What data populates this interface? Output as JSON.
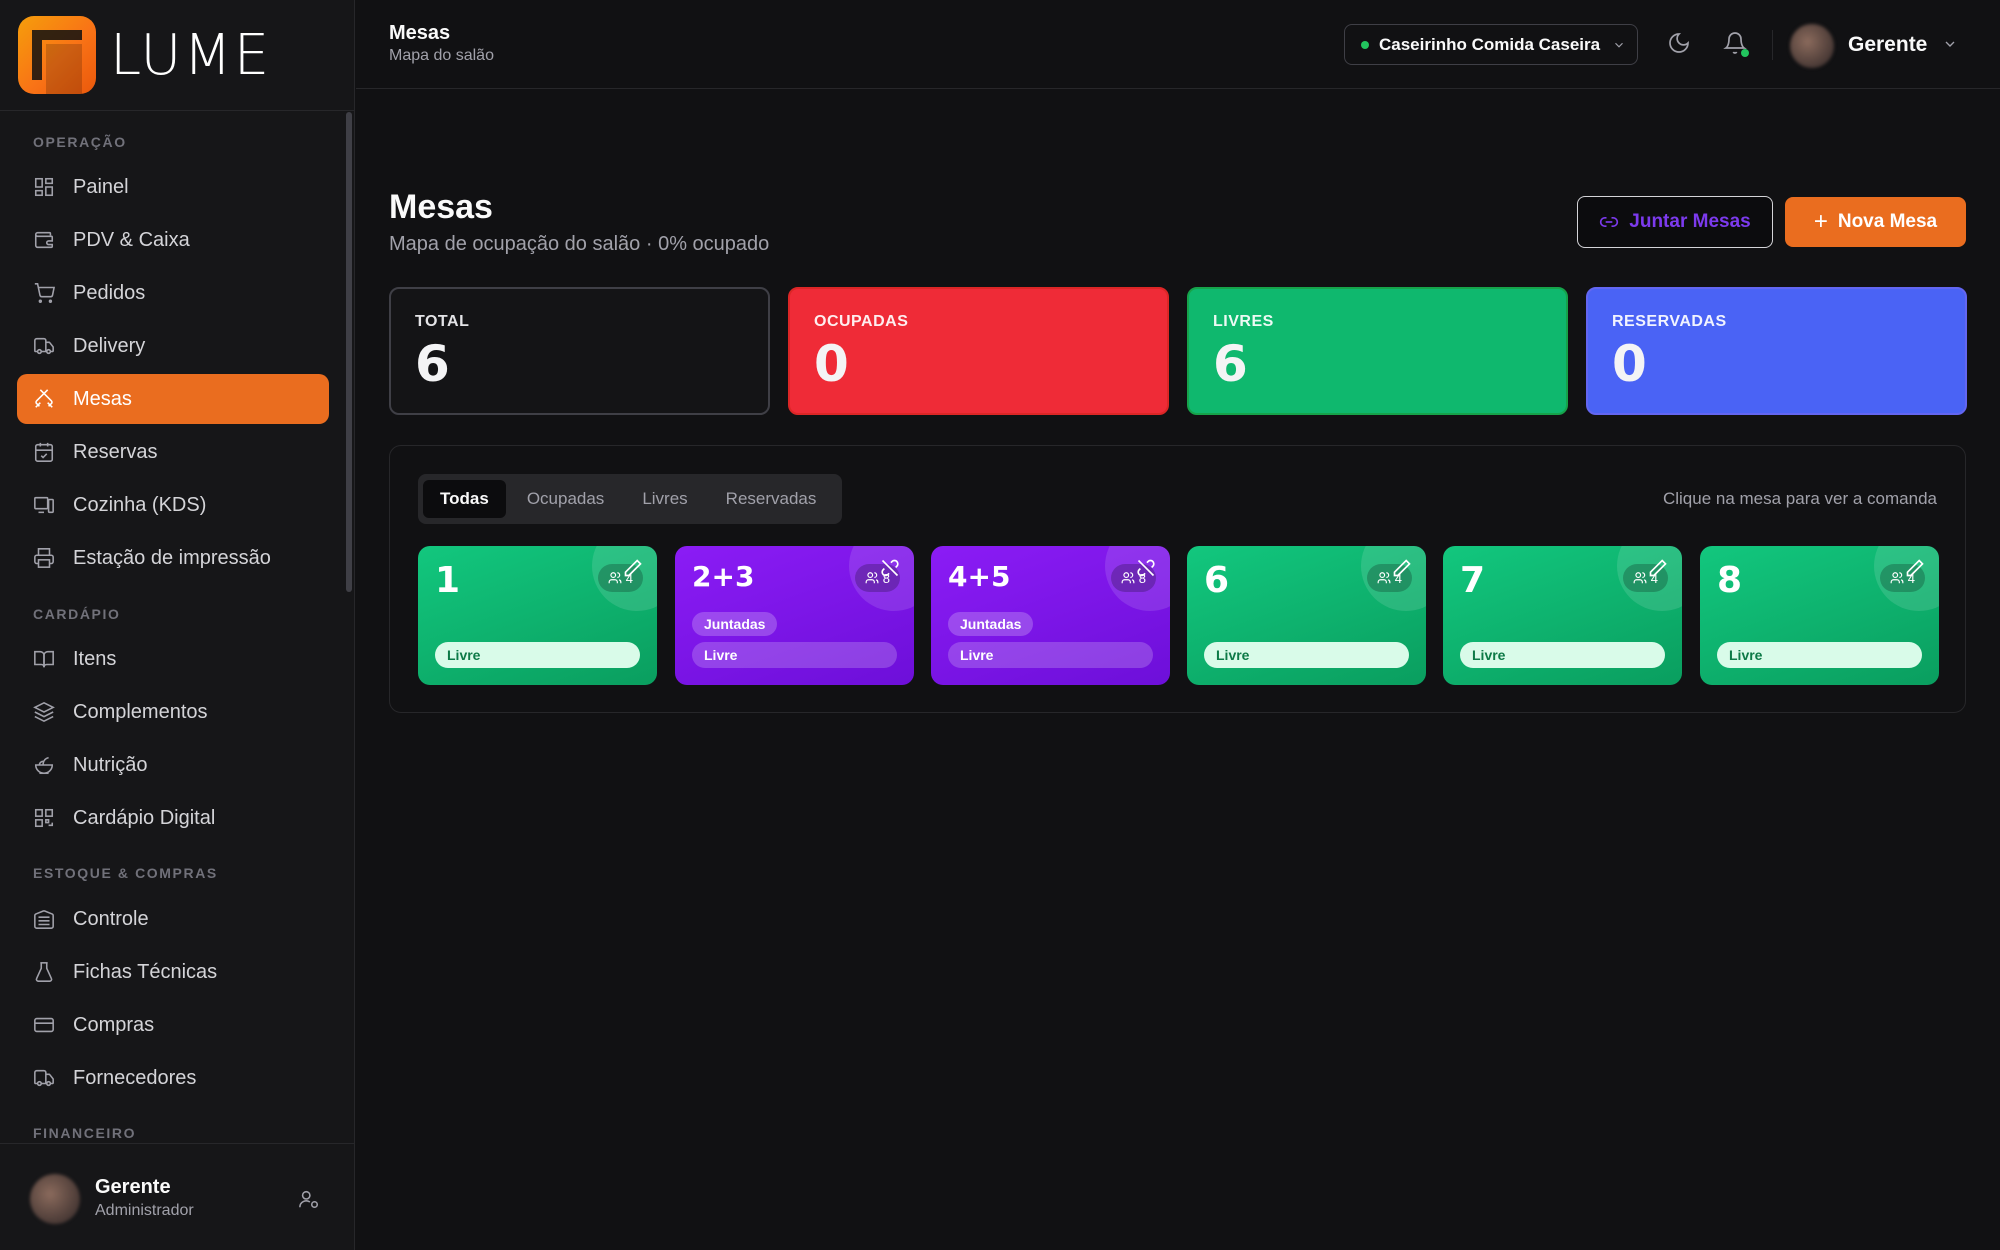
{
  "brand": {
    "name": "LUME"
  },
  "sidebar": {
    "sections": {
      "operacao": "OPERAÇÃO",
      "cardapio": "CARDÁPIO",
      "estoque": "ESTOQUE & COMPRAS",
      "financeiro": "FINANCEIRO"
    },
    "items": [
      {
        "label": "Painel",
        "icon": "grid-icon"
      },
      {
        "label": "PDV & Caixa",
        "icon": "wallet-icon"
      },
      {
        "label": "Pedidos",
        "icon": "cart-icon"
      },
      {
        "label": "Delivery",
        "icon": "truck-icon"
      },
      {
        "label": "Mesas",
        "icon": "utensils-icon",
        "active": true
      },
      {
        "label": "Reservas",
        "icon": "calendar-icon"
      },
      {
        "label": "Cozinha (KDS)",
        "icon": "monitor-icon"
      },
      {
        "label": "Estação de impressão",
        "icon": "printer-icon"
      },
      {
        "label": "Itens",
        "icon": "book-icon"
      },
      {
        "label": "Complementos",
        "icon": "layers-icon"
      },
      {
        "label": "Nutrição",
        "icon": "salad-icon"
      },
      {
        "label": "Cardápio Digital",
        "icon": "qr-icon"
      },
      {
        "label": "Controle",
        "icon": "warehouse-icon"
      },
      {
        "label": "Fichas Técnicas",
        "icon": "flask-icon"
      },
      {
        "label": "Compras",
        "icon": "credit-card-icon"
      },
      {
        "label": "Fornecedores",
        "icon": "truck-icon"
      }
    ],
    "user": {
      "name": "Gerente",
      "role": "Administrador"
    }
  },
  "header": {
    "title": "Mesas",
    "subtitle": "Mapa do salão",
    "store": "Caseirinho Comida Caseira",
    "user": "Gerente"
  },
  "main": {
    "title": "Mesas",
    "subtitle": "Mapa de ocupação do salão · 0% ocupado",
    "join_button": "Juntar Mesas",
    "new_button": "Nova Mesa",
    "stats": [
      {
        "label": "TOTAL",
        "value": "6",
        "color": "#141416"
      },
      {
        "label": "OCUPADAS",
        "value": "0",
        "color": "#ef2b37"
      },
      {
        "label": "LIVRES",
        "value": "6",
        "color": "#0fb86e"
      },
      {
        "label": "RESERVADAS",
        "value": "0",
        "color": "#4a63f5"
      }
    ],
    "tabs": [
      "Todas",
      "Ocupadas",
      "Livres",
      "Reservadas"
    ],
    "active_tab": "Todas",
    "hint": "Clique na mesa para ver a comanda",
    "tables": [
      {
        "number": "1",
        "capacity": "4",
        "status": "Livre",
        "joined": null,
        "color": "#0fb86e"
      },
      {
        "number": "2+3",
        "capacity": "8",
        "status": "Livre",
        "joined": "Juntadas",
        "color": "#7c14ee"
      },
      {
        "number": "4+5",
        "capacity": "8",
        "status": "Livre",
        "joined": "Juntadas",
        "color": "#7c14ee"
      },
      {
        "number": "6",
        "capacity": "4",
        "status": "Livre",
        "joined": null,
        "color": "#0fb86e"
      },
      {
        "number": "7",
        "capacity": "4",
        "status": "Livre",
        "joined": null,
        "color": "#0fb86e"
      },
      {
        "number": "8",
        "capacity": "4",
        "status": "Livre",
        "joined": null,
        "color": "#0fb86e"
      }
    ]
  }
}
